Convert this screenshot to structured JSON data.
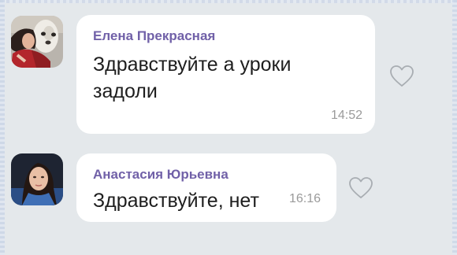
{
  "messages": [
    {
      "sender": "Елена Прекрасная",
      "text": "Здравствуйте а уроки задоли",
      "time": "14:52",
      "like_icon": "heart-outline-icon"
    },
    {
      "sender": "Анастасия Юрьевна",
      "text": "Здравствуйте, нет",
      "time": "16:16",
      "like_icon": "heart-outline-icon"
    }
  ],
  "colors": {
    "background": "#e4e8eb",
    "bubble": "#ffffff",
    "sender_name": "#7161a8",
    "message_text": "#1e1e1e",
    "timestamp": "#9a9a9a",
    "like_outline": "#a8adb2"
  }
}
